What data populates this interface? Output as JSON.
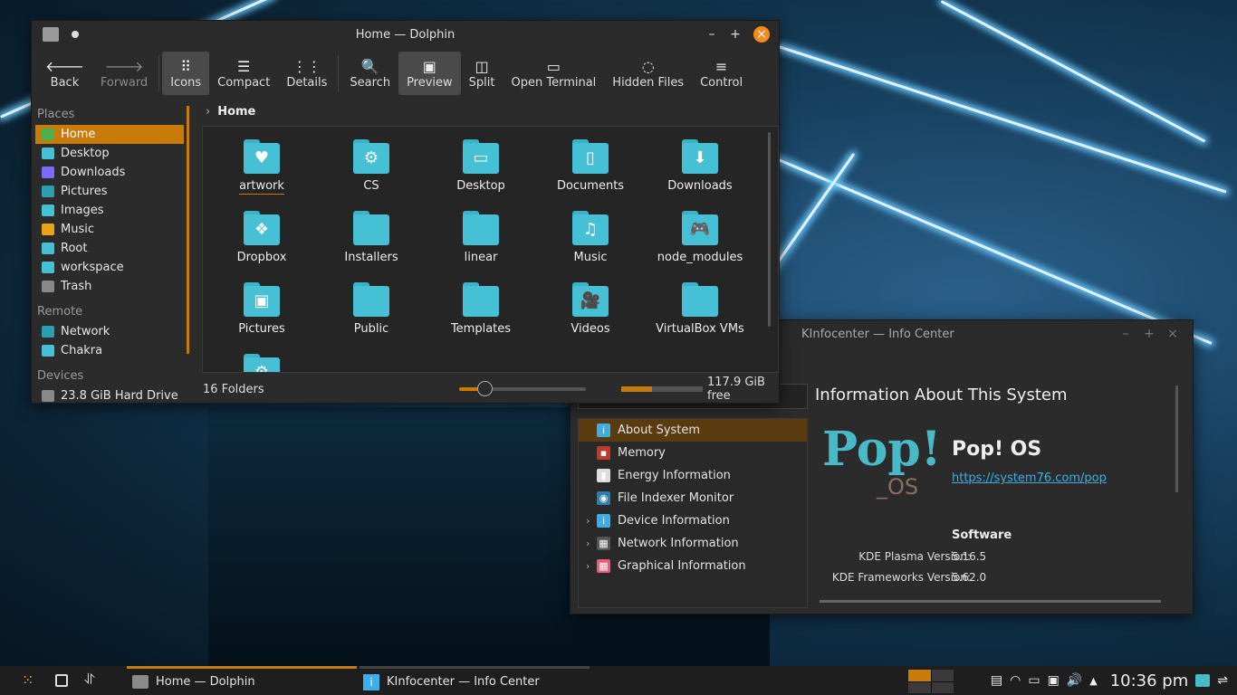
{
  "dolphin": {
    "title": "Home — Dolphin",
    "toolbar": [
      {
        "label": "Back",
        "icon": "back-arrow-icon",
        "glyph": "🡐",
        "state": "normal"
      },
      {
        "label": "Forward",
        "icon": "forward-arrow-icon",
        "glyph": "🡒",
        "state": "disabled"
      },
      {
        "label": "Icons",
        "icon": "icons-view-icon",
        "glyph": "⠿",
        "state": "active"
      },
      {
        "label": "Compact",
        "icon": "compact-view-icon",
        "glyph": "☰",
        "state": "normal"
      },
      {
        "label": "Details",
        "icon": "details-view-icon",
        "glyph": "⋮⋮",
        "state": "normal"
      },
      {
        "label": "Search",
        "icon": "search-icon",
        "glyph": "🔍",
        "state": "normal"
      },
      {
        "label": "Preview",
        "icon": "preview-icon",
        "glyph": "▣",
        "state": "active"
      },
      {
        "label": "Split",
        "icon": "split-icon",
        "glyph": "◫",
        "state": "normal"
      },
      {
        "label": "Open Terminal",
        "icon": "terminal-icon",
        "glyph": "▭",
        "state": "normal"
      },
      {
        "label": "Hidden Files",
        "icon": "hidden-files-icon",
        "glyph": "◌",
        "state": "normal"
      },
      {
        "label": "Control",
        "icon": "hamburger-menu-icon",
        "glyph": "≡",
        "state": "normal"
      }
    ],
    "places_header": "Places",
    "places": [
      {
        "label": "Home",
        "icon": "home-icon",
        "color": "#4caf50",
        "selected": true
      },
      {
        "label": "Desktop",
        "icon": "desktop-folder-icon",
        "color": "#45c0d5"
      },
      {
        "label": "Downloads",
        "icon": "downloads-icon",
        "color": "#7a6cff"
      },
      {
        "label": "Pictures",
        "icon": "pictures-folder-icon",
        "color": "#2a9fb0"
      },
      {
        "label": "Images",
        "icon": "folder-icon",
        "color": "#45c0d5"
      },
      {
        "label": "Music",
        "icon": "music-icon",
        "color": "#e8a317"
      },
      {
        "label": "Root",
        "icon": "root-folder-icon",
        "color": "#45c0d5"
      },
      {
        "label": "workspace",
        "icon": "folder-icon",
        "color": "#45c0d5"
      },
      {
        "label": "Trash",
        "icon": "trash-icon",
        "color": "#888888"
      }
    ],
    "remote_header": "Remote",
    "remote": [
      {
        "label": "Network",
        "icon": "network-icon",
        "color": "#2a9fb0"
      },
      {
        "label": "Chakra",
        "icon": "folder-icon",
        "color": "#45c0d5"
      }
    ],
    "devices_header": "Devices",
    "devices": [
      {
        "label": "23.8 GiB Hard Drive",
        "icon": "hard-drive-icon",
        "color": "#888888"
      }
    ],
    "breadcrumb": "Home",
    "folders": [
      {
        "name": "artwork",
        "glyph": "♥"
      },
      {
        "name": "CS",
        "glyph": "⚙"
      },
      {
        "name": "Desktop",
        "glyph": "▭"
      },
      {
        "name": "Documents",
        "glyph": "▯"
      },
      {
        "name": "Downloads",
        "glyph": "⬇"
      },
      {
        "name": "Dropbox",
        "glyph": "❖"
      },
      {
        "name": "Installers",
        "glyph": ""
      },
      {
        "name": "linear",
        "glyph": ""
      },
      {
        "name": "Music",
        "glyph": "♫"
      },
      {
        "name": "node_modules",
        "glyph": "🎮"
      },
      {
        "name": "Pictures",
        "glyph": "▣"
      },
      {
        "name": "Public",
        "glyph": ""
      },
      {
        "name": "Templates",
        "glyph": ""
      },
      {
        "name": "Videos",
        "glyph": "🎥"
      },
      {
        "name": "VirtualBox VMs",
        "glyph": ""
      },
      {
        "name": "",
        "glyph": "⚙"
      }
    ],
    "status": {
      "count": "16 Folders",
      "zoom_fraction": 0.2,
      "disk_used_fraction": 0.38,
      "free": "117.9 GiB free"
    }
  },
  "kinfo": {
    "title": "KInfocenter — Info Center",
    "tree": [
      {
        "label": "About System",
        "icon": "info-icon",
        "glyph": "i",
        "color": "#3daee9",
        "selected": true,
        "expandable": false
      },
      {
        "label": "Memory",
        "icon": "memory-icon",
        "glyph": "▪",
        "color": "#c0392b",
        "expandable": false
      },
      {
        "label": "Energy Information",
        "icon": "battery-icon",
        "glyph": "▮",
        "color": "#dddddd",
        "expandable": false
      },
      {
        "label": "File Indexer Monitor",
        "icon": "file-indexer-icon",
        "glyph": "◉",
        "color": "#2a7fb0",
        "expandable": false
      },
      {
        "label": "Device Information",
        "icon": "info-icon",
        "glyph": "i",
        "color": "#3daee9",
        "expandable": true
      },
      {
        "label": "Network Information",
        "icon": "network-info-icon",
        "glyph": "▦",
        "color": "#555555",
        "expandable": true
      },
      {
        "label": "Graphical Information",
        "icon": "graphics-icon",
        "glyph": "▦",
        "color": "#e85d75",
        "expandable": true
      }
    ],
    "heading": "Information About This System",
    "os_name": "Pop! OS",
    "os_url": "https://system76.com/pop",
    "logo_text": "Pop!",
    "logo_sub": "_OS",
    "software_header": "Software",
    "rows": [
      {
        "key": "KDE Plasma Version:",
        "value": "5.16.5"
      },
      {
        "key": "KDE Frameworks Version:",
        "value": "5.62.0"
      }
    ]
  },
  "taskbar": {
    "tasks": [
      {
        "label": "Home — Dolphin",
        "icon": "dolphin-icon"
      },
      {
        "label": "KInfocenter — Info Center",
        "icon": "info-icon"
      }
    ],
    "clock": "10:36 pm"
  },
  "colors": {
    "accent": "#c97b0a",
    "folder": "#45c0d5"
  }
}
